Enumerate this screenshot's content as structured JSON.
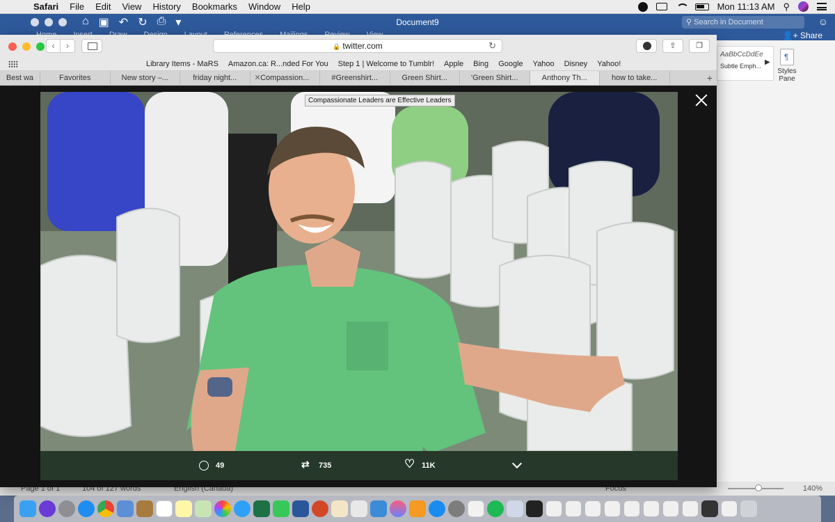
{
  "menubar": {
    "apple": "",
    "app_name": "Safari",
    "items": [
      "File",
      "Edit",
      "View",
      "History",
      "Bookmarks",
      "Window",
      "Help"
    ],
    "clock": "Mon 11:13 AM"
  },
  "word": {
    "doc_title": "Document9",
    "search_placeholder": "Search in Document",
    "share_label": "Share",
    "ribbon_tabs": [
      "Home",
      "Insert",
      "Draw",
      "Design",
      "Layout",
      "References",
      "Mailings",
      "Review",
      "View"
    ],
    "style_sample": "AaBbCcDdEe",
    "style_name": "Subtle Emph...",
    "styles_pane_label": "Styles Pane",
    "status_page": "Page 1 of 1",
    "status_words": "104 of 127 words",
    "status_lang": "English (Canada)",
    "status_focus": "Focus",
    "zoom": "140%"
  },
  "safari": {
    "url": "twitter.com",
    "bookmarks": [
      "Library Items - MaRS",
      "Amazon.ca: R...nded For You",
      "Step 1 | Welcome to Tumblr!",
      "Apple",
      "Bing",
      "Google",
      "Yahoo",
      "Disney",
      "Yahoo!"
    ],
    "tabs": [
      {
        "label": "Best wa",
        "active": false
      },
      {
        "label": "Favorites",
        "active": false
      },
      {
        "label": "New story –...",
        "active": false
      },
      {
        "label": "friday night...",
        "active": false
      },
      {
        "label": "Compassion...",
        "active": false
      },
      {
        "label": "#Greenshirt...",
        "active": false
      },
      {
        "label": "Green Shirt...",
        "active": false
      },
      {
        "label": "'Green Shirt...",
        "active": false
      },
      {
        "label": "Anthony Th...",
        "active": true
      },
      {
        "label": "how to take...",
        "active": false
      }
    ]
  },
  "viewer": {
    "caption": "Compassionate Leaders are Effective Leaders",
    "replies": "49",
    "retweets": "735",
    "likes": "11K"
  },
  "colors": {
    "word_blue": "#2e5a9c",
    "shirt_green": "#63c27c",
    "action_bar": "#263829"
  }
}
